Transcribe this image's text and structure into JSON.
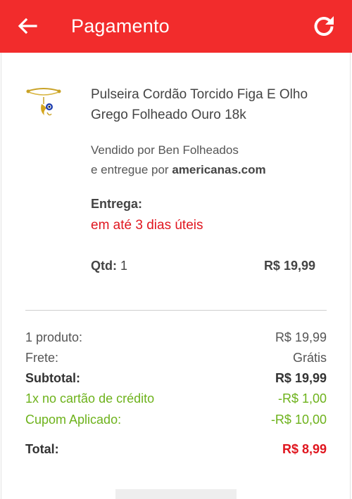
{
  "header": {
    "title": "Pagamento",
    "back_icon": "arrow-back-icon",
    "refresh_icon": "refresh-icon",
    "bg_color": "#f22c2c"
  },
  "product": {
    "image_icon": "bracelet-thumbnail",
    "name": "Pulseira Cordão Torcido Figa E Olho Grego Folheado Ouro 18k",
    "sold_by": "Vendido por Ben Folheados",
    "delivered_prefix": "e entregue por",
    "delivered_by": "americanas.com",
    "delivery_label": "Entrega:",
    "delivery_value": "em até 3 dias úteis",
    "qty_label": "Qtd:",
    "qty_value": "1",
    "price": "R$ 19,99"
  },
  "summary": {
    "rows": [
      {
        "label": "1 produto:",
        "value": "R$ 19,99"
      },
      {
        "label": "Frete:",
        "value": "Grátis"
      },
      {
        "label": "Subtotal:",
        "value": "R$ 19,99"
      },
      {
        "label": "1x no cartão de crédito",
        "value": "-R$ 1,00"
      },
      {
        "label": "Cupom Aplicado:",
        "value": "-R$ 10,00"
      }
    ],
    "total_label": "Total:",
    "total_value": "R$ 8,99",
    "discount_color": "#6db21b",
    "total_color": "#e0161f"
  }
}
